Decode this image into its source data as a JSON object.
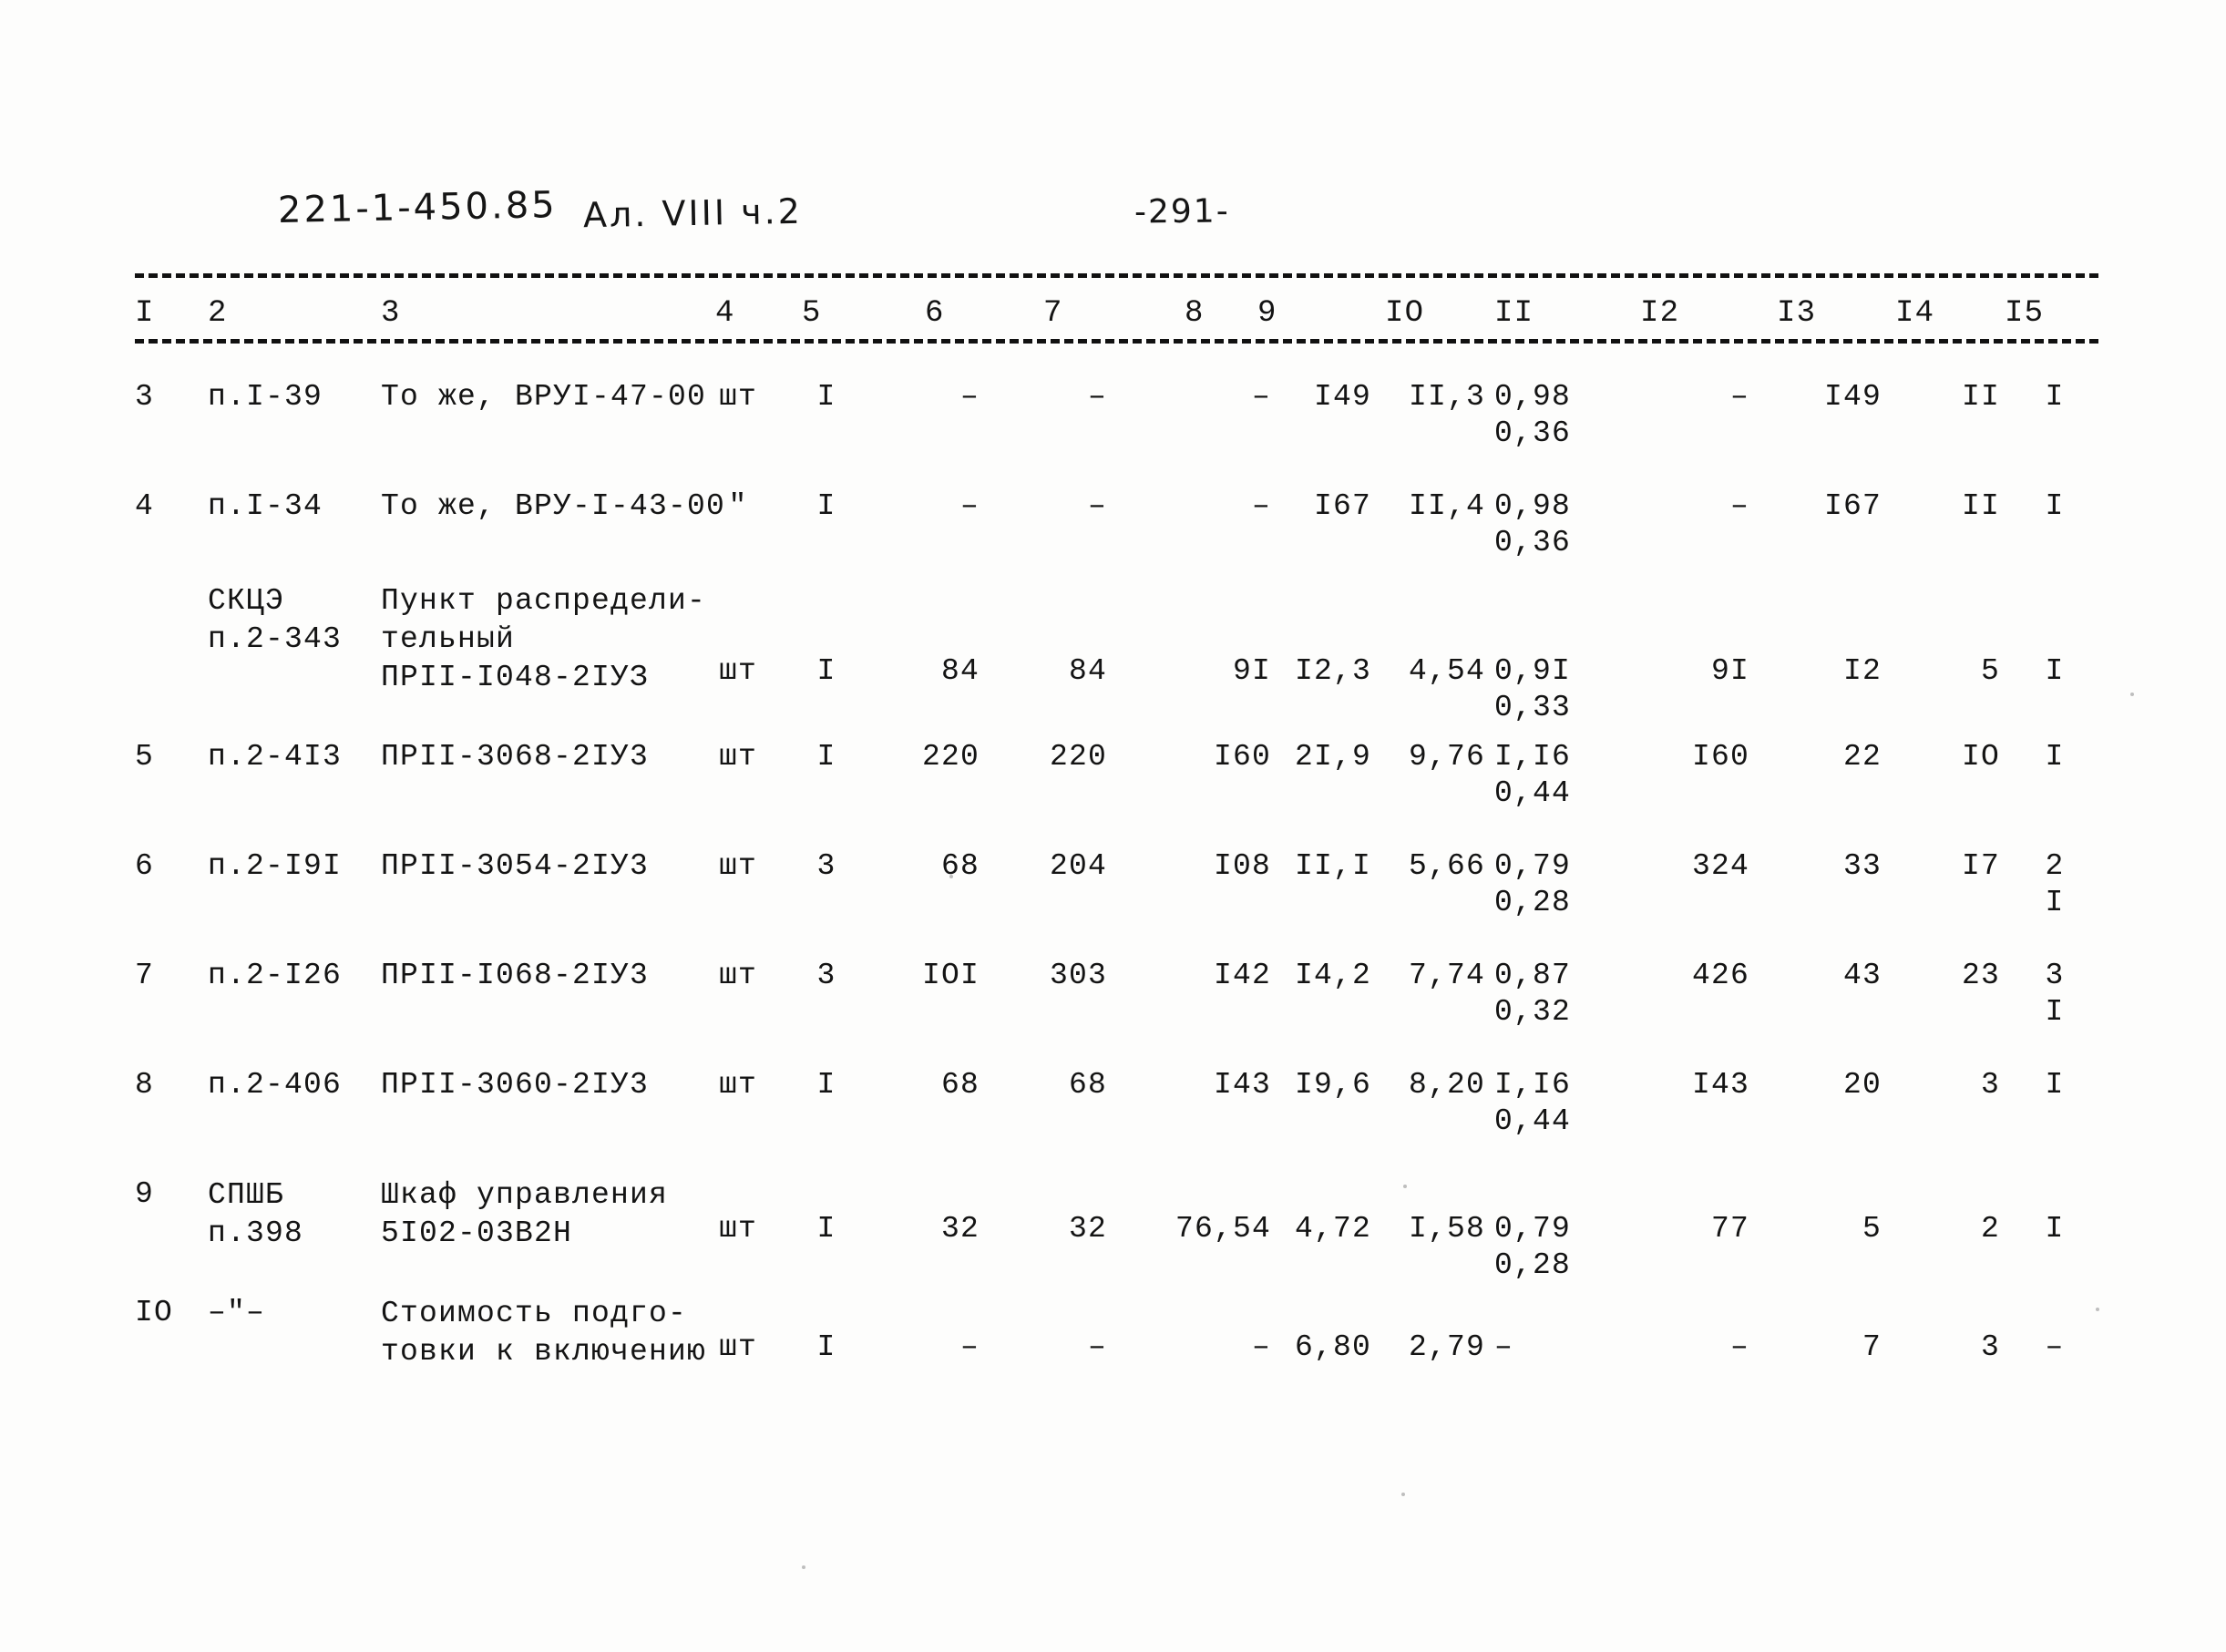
{
  "header": {
    "handwritten_code": "221-1-450.85",
    "handwritten_album": "Ал. VIII ч.2",
    "page_number": "-291-"
  },
  "table": {
    "column_headers": [
      "I",
      "2",
      "3",
      "4",
      "5",
      "6",
      "7",
      "8",
      "9",
      "IO",
      "II",
      "I2",
      "I3",
      "I4",
      "I5"
    ],
    "rows": [
      {
        "c1": "3",
        "c2": "п.I-39",
        "c3": "То же, ВРУI-47-00",
        "c4": "шт",
        "c5": "I",
        "c6": "–",
        "c7": "–",
        "c8": "–",
        "c9": "I49",
        "c10": "II,3",
        "c11": "0,98",
        "c11b": "0,36",
        "c12": "–",
        "c13": "I49",
        "c14": "II",
        "c15": "I"
      },
      {
        "c1": "4",
        "c2": "п.I-34",
        "c3": "То же, ВРУ-I-43-00",
        "c4": "\"",
        "c5": "I",
        "c6": "–",
        "c7": "–",
        "c8": "–",
        "c9": "I67",
        "c10": "II,4",
        "c11": "0,98",
        "c11b": "0,36",
        "c12": "–",
        "c13": "I67",
        "c14": "II",
        "c15": "I"
      },
      {
        "c1": "",
        "c2": "СКЦЭ",
        "c2b": "п.2-343",
        "c3": "Пункт распредели-",
        "c3b": "тельный",
        "c3c": "ПРII-I048-2IУЗ",
        "c4": "шт",
        "c5": "I",
        "c6": "84",
        "c7": "84",
        "c8": "9I",
        "c9": "I2,3",
        "c10": "4,54",
        "c11": "0,9I",
        "c11b": "0,33",
        "c12": "9I",
        "c13": "I2",
        "c14": "5",
        "c15": "I"
      },
      {
        "c1": "5",
        "c2": "п.2-4I3",
        "c3": "ПРII-3068-2IУ3",
        "c4": "шт",
        "c5": "I",
        "c6": "220",
        "c7": "220",
        "c8": "I60",
        "c9": "2I,9",
        "c10": "9,76",
        "c11": "I,I6",
        "c11b": "0,44",
        "c12": "I60",
        "c13": "22",
        "c14": "IO",
        "c15": "I"
      },
      {
        "c1": "6",
        "c2": "п.2-I9I",
        "c3": "ПРII-3054-2IУ3",
        "c4": "шт",
        "c5": "3",
        "c6": "68",
        "c7": "204",
        "c8": "I08",
        "c9": "II,I",
        "c10": "5,66",
        "c11": "0,79",
        "c11b": "0,28",
        "c12": "324",
        "c13": "33",
        "c14": "I7",
        "c15": "2",
        "c15b": "I"
      },
      {
        "c1": "7",
        "c2": "п.2-I26",
        "c3": "ПРII-I068-2IУ3",
        "c4": "шт",
        "c5": "3",
        "c6": "IOI",
        "c7": "303",
        "c8": "I42",
        "c9": "I4,2",
        "c10": "7,74",
        "c11": "0,87",
        "c11b": "0,32",
        "c12": "426",
        "c13": "43",
        "c14": "23",
        "c15": "3",
        "c15b": "I"
      },
      {
        "c1": "8",
        "c2": "п.2-406",
        "c3": "ПРII-3060-2IУ3",
        "c4": "шт",
        "c5": "I",
        "c6": "68",
        "c7": "68",
        "c8": "I43",
        "c9": "I9,6",
        "c10": "8,20",
        "c11": "I,I6",
        "c11b": "0,44",
        "c12": "I43",
        "c13": "20",
        "c14": "3",
        "c15": "I"
      },
      {
        "c1": "9",
        "c2": "СПШБ",
        "c2b": "п.398",
        "c3": "Шкаф управления",
        "c3b": "5I02-03В2Н",
        "c4": "шт",
        "c5": "I",
        "c6": "32",
        "c7": "32",
        "c8": "76,54",
        "c9": "4,72",
        "c10": "I,58",
        "c11": "0,79",
        "c11b": "0,28",
        "c12": "77",
        "c13": "5",
        "c14": "2",
        "c15": "I"
      },
      {
        "c1": "IO",
        "c2": "–\"–",
        "c3": "Стоимость подго-",
        "c3b": "товки к включению",
        "c4": "шт",
        "c5": "I",
        "c6": "–",
        "c7": "–",
        "c8": "–",
        "c9": "6,80",
        "c10": "2,79",
        "c11": "–",
        "c12": "–",
        "c13": "7",
        "c14": "3",
        "c15": "–"
      }
    ]
  }
}
